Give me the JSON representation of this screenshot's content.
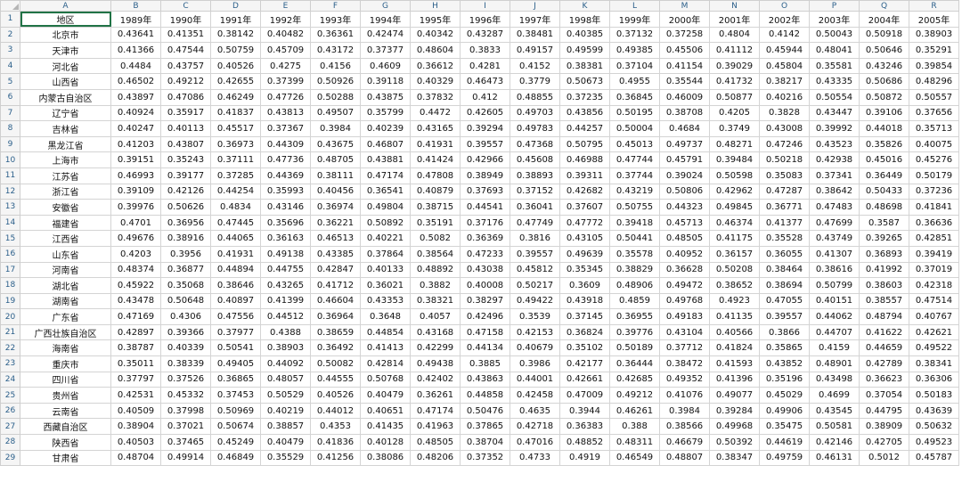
{
  "columns": [
    "A",
    "B",
    "C",
    "D",
    "E",
    "F",
    "G",
    "H",
    "I",
    "J",
    "K",
    "L",
    "M",
    "N",
    "O",
    "P",
    "Q",
    "R"
  ],
  "header_row": {
    "row_number": "1",
    "cells": [
      "地区",
      "1989年",
      "1990年",
      "1991年",
      "1992年",
      "1993年",
      "1994年",
      "1995年",
      "1996年",
      "1997年",
      "1998年",
      "1999年",
      "2000年",
      "2001年",
      "2002年",
      "2003年",
      "2004年",
      "2005年"
    ]
  },
  "rows": [
    {
      "n": "2",
      "region": "北京市",
      "values": [
        "0.43641",
        "0.41351",
        "0.38142",
        "0.40482",
        "0.36361",
        "0.42474",
        "0.40342",
        "0.43287",
        "0.38481",
        "0.40385",
        "0.37132",
        "0.37258",
        "0.4804",
        "0.4142",
        "0.50043",
        "0.50918",
        "0.38903"
      ]
    },
    {
      "n": "3",
      "region": "天津市",
      "values": [
        "0.41366",
        "0.47544",
        "0.50759",
        "0.45709",
        "0.43172",
        "0.37377",
        "0.48604",
        "0.3833",
        "0.49157",
        "0.49599",
        "0.49385",
        "0.45506",
        "0.41112",
        "0.45944",
        "0.48041",
        "0.50646",
        "0.35291"
      ]
    },
    {
      "n": "4",
      "region": "河北省",
      "values": [
        "0.4484",
        "0.43757",
        "0.40526",
        "0.4275",
        "0.4156",
        "0.4609",
        "0.36612",
        "0.4281",
        "0.4152",
        "0.38381",
        "0.37104",
        "0.41154",
        "0.39029",
        "0.45804",
        "0.35581",
        "0.43246",
        "0.39854"
      ]
    },
    {
      "n": "5",
      "region": "山西省",
      "values": [
        "0.46502",
        "0.49212",
        "0.42655",
        "0.37399",
        "0.50926",
        "0.39118",
        "0.40329",
        "0.46473",
        "0.3779",
        "0.50673",
        "0.4955",
        "0.35544",
        "0.41732",
        "0.38217",
        "0.43335",
        "0.50686",
        "0.48296"
      ]
    },
    {
      "n": "6",
      "region": "内蒙古自治区",
      "values": [
        "0.43897",
        "0.47086",
        "0.46249",
        "0.47726",
        "0.50288",
        "0.43875",
        "0.37832",
        "0.412",
        "0.48855",
        "0.37235",
        "0.36845",
        "0.46009",
        "0.50877",
        "0.40216",
        "0.50554",
        "0.50872",
        "0.50557"
      ]
    },
    {
      "n": "7",
      "region": "辽宁省",
      "values": [
        "0.40924",
        "0.35917",
        "0.41837",
        "0.43813",
        "0.49507",
        "0.35799",
        "0.4472",
        "0.42605",
        "0.49703",
        "0.43856",
        "0.50195",
        "0.38708",
        "0.4205",
        "0.3828",
        "0.43447",
        "0.39106",
        "0.37656"
      ]
    },
    {
      "n": "8",
      "region": "吉林省",
      "values": [
        "0.40247",
        "0.40113",
        "0.45517",
        "0.37367",
        "0.3984",
        "0.40239",
        "0.43165",
        "0.39294",
        "0.49783",
        "0.44257",
        "0.50004",
        "0.4684",
        "0.3749",
        "0.43008",
        "0.39992",
        "0.44018",
        "0.35713"
      ]
    },
    {
      "n": "9",
      "region": "黑龙江省",
      "values": [
        "0.41203",
        "0.43807",
        "0.36973",
        "0.44309",
        "0.43675",
        "0.46807",
        "0.41931",
        "0.39557",
        "0.47368",
        "0.50795",
        "0.45013",
        "0.49737",
        "0.48271",
        "0.47246",
        "0.43523",
        "0.35826",
        "0.40075"
      ]
    },
    {
      "n": "10",
      "region": "上海市",
      "values": [
        "0.39151",
        "0.35243",
        "0.37111",
        "0.47736",
        "0.48705",
        "0.43881",
        "0.41424",
        "0.42966",
        "0.45608",
        "0.46988",
        "0.47744",
        "0.45791",
        "0.39484",
        "0.50218",
        "0.42938",
        "0.45016",
        "0.45276"
      ]
    },
    {
      "n": "11",
      "region": "江苏省",
      "values": [
        "0.46993",
        "0.39177",
        "0.37285",
        "0.44369",
        "0.38111",
        "0.47174",
        "0.47808",
        "0.38949",
        "0.38893",
        "0.39311",
        "0.37744",
        "0.39024",
        "0.50598",
        "0.35083",
        "0.37341",
        "0.36449",
        "0.50179"
      ]
    },
    {
      "n": "12",
      "region": "浙江省",
      "values": [
        "0.39109",
        "0.42126",
        "0.44254",
        "0.35993",
        "0.40456",
        "0.36541",
        "0.40879",
        "0.37693",
        "0.37152",
        "0.42682",
        "0.43219",
        "0.50806",
        "0.42962",
        "0.47287",
        "0.38642",
        "0.50433",
        "0.37236"
      ]
    },
    {
      "n": "13",
      "region": "安徽省",
      "values": [
        "0.39976",
        "0.50626",
        "0.4834",
        "0.43146",
        "0.36974",
        "0.49804",
        "0.38715",
        "0.44541",
        "0.36041",
        "0.37607",
        "0.50755",
        "0.44323",
        "0.49845",
        "0.36771",
        "0.47483",
        "0.48698",
        "0.41841"
      ]
    },
    {
      "n": "14",
      "region": "福建省",
      "values": [
        "0.4701",
        "0.36956",
        "0.47445",
        "0.35696",
        "0.36221",
        "0.50892",
        "0.35191",
        "0.37176",
        "0.47749",
        "0.47772",
        "0.39418",
        "0.45713",
        "0.46374",
        "0.41377",
        "0.47699",
        "0.3587",
        "0.36636"
      ]
    },
    {
      "n": "15",
      "region": "江西省",
      "values": [
        "0.49676",
        "0.38916",
        "0.44065",
        "0.36163",
        "0.46513",
        "0.40221",
        "0.5082",
        "0.36369",
        "0.3816",
        "0.43105",
        "0.50441",
        "0.48505",
        "0.41175",
        "0.35528",
        "0.43749",
        "0.39265",
        "0.42851"
      ]
    },
    {
      "n": "16",
      "region": "山东省",
      "values": [
        "0.4203",
        "0.3956",
        "0.41931",
        "0.49138",
        "0.43385",
        "0.37864",
        "0.38564",
        "0.47233",
        "0.39557",
        "0.49639",
        "0.35578",
        "0.40952",
        "0.36157",
        "0.36055",
        "0.41307",
        "0.36893",
        "0.39419"
      ]
    },
    {
      "n": "17",
      "region": "河南省",
      "values": [
        "0.48374",
        "0.36877",
        "0.44894",
        "0.44755",
        "0.42847",
        "0.40133",
        "0.48892",
        "0.43038",
        "0.45812",
        "0.35345",
        "0.38829",
        "0.36628",
        "0.50208",
        "0.38464",
        "0.38616",
        "0.41992",
        "0.37019"
      ]
    },
    {
      "n": "18",
      "region": "湖北省",
      "values": [
        "0.45922",
        "0.35068",
        "0.38646",
        "0.43265",
        "0.41712",
        "0.36021",
        "0.3882",
        "0.40008",
        "0.50217",
        "0.3609",
        "0.48906",
        "0.49472",
        "0.38652",
        "0.38694",
        "0.50799",
        "0.38603",
        "0.42318"
      ]
    },
    {
      "n": "19",
      "region": "湖南省",
      "values": [
        "0.43478",
        "0.50648",
        "0.40897",
        "0.41399",
        "0.46604",
        "0.43353",
        "0.38321",
        "0.38297",
        "0.49422",
        "0.43918",
        "0.4859",
        "0.49768",
        "0.4923",
        "0.47055",
        "0.40151",
        "0.38557",
        "0.47514"
      ]
    },
    {
      "n": "20",
      "region": "广东省",
      "values": [
        "0.47169",
        "0.4306",
        "0.47556",
        "0.44512",
        "0.36964",
        "0.3648",
        "0.4057",
        "0.42496",
        "0.3539",
        "0.37145",
        "0.36955",
        "0.49183",
        "0.41135",
        "0.39557",
        "0.44062",
        "0.48794",
        "0.40767"
      ]
    },
    {
      "n": "21",
      "region": "广西壮族自治区",
      "values": [
        "0.42897",
        "0.39366",
        "0.37977",
        "0.4388",
        "0.38659",
        "0.44854",
        "0.43168",
        "0.47158",
        "0.42153",
        "0.36824",
        "0.39776",
        "0.43104",
        "0.40566",
        "0.3866",
        "0.44707",
        "0.41622",
        "0.42621"
      ]
    },
    {
      "n": "22",
      "region": "海南省",
      "values": [
        "0.38787",
        "0.40339",
        "0.50541",
        "0.38903",
        "0.36492",
        "0.41413",
        "0.42299",
        "0.44134",
        "0.40679",
        "0.35102",
        "0.50189",
        "0.37712",
        "0.41824",
        "0.35865",
        "0.4159",
        "0.44659",
        "0.49522"
      ]
    },
    {
      "n": "23",
      "region": "重庆市",
      "values": [
        "0.35011",
        "0.38339",
        "0.49405",
        "0.44092",
        "0.50082",
        "0.42814",
        "0.49438",
        "0.3885",
        "0.3986",
        "0.42177",
        "0.36444",
        "0.38472",
        "0.41593",
        "0.43852",
        "0.48901",
        "0.42789",
        "0.38341"
      ]
    },
    {
      "n": "24",
      "region": "四川省",
      "values": [
        "0.37797",
        "0.37526",
        "0.36865",
        "0.48057",
        "0.44555",
        "0.50768",
        "0.42402",
        "0.43863",
        "0.44001",
        "0.42661",
        "0.42685",
        "0.49352",
        "0.41396",
        "0.35196",
        "0.43498",
        "0.36623",
        "0.36306"
      ]
    },
    {
      "n": "25",
      "region": "贵州省",
      "values": [
        "0.42531",
        "0.45332",
        "0.37453",
        "0.50529",
        "0.40526",
        "0.40479",
        "0.36261",
        "0.44858",
        "0.42458",
        "0.47009",
        "0.49212",
        "0.41076",
        "0.49077",
        "0.45029",
        "0.4699",
        "0.37054",
        "0.50183"
      ]
    },
    {
      "n": "26",
      "region": "云南省",
      "values": [
        "0.40509",
        "0.37998",
        "0.50969",
        "0.40219",
        "0.44012",
        "0.40651",
        "0.47174",
        "0.50476",
        "0.4635",
        "0.3944",
        "0.46261",
        "0.3984",
        "0.39284",
        "0.49906",
        "0.43545",
        "0.44795",
        "0.43639"
      ]
    },
    {
      "n": "27",
      "region": "西藏自治区",
      "values": [
        "0.38904",
        "0.37021",
        "0.50674",
        "0.38857",
        "0.4353",
        "0.41435",
        "0.41963",
        "0.37865",
        "0.42718",
        "0.36383",
        "0.388",
        "0.38566",
        "0.49968",
        "0.35475",
        "0.50581",
        "0.38909",
        "0.50632"
      ]
    },
    {
      "n": "28",
      "region": "陕西省",
      "values": [
        "0.40503",
        "0.37465",
        "0.45249",
        "0.40479",
        "0.41836",
        "0.40128",
        "0.48505",
        "0.38704",
        "0.47016",
        "0.48852",
        "0.48311",
        "0.46679",
        "0.50392",
        "0.44619",
        "0.42146",
        "0.42705",
        "0.49523"
      ]
    },
    {
      "n": "29",
      "region": "甘肃省",
      "values": [
        "0.48704",
        "0.49914",
        "0.46849",
        "0.35529",
        "0.41256",
        "0.38086",
        "0.48206",
        "0.37352",
        "0.4733",
        "0.4919",
        "0.46549",
        "0.48807",
        "0.38347",
        "0.49759",
        "0.46131",
        "0.5012",
        "0.45787"
      ]
    }
  ]
}
